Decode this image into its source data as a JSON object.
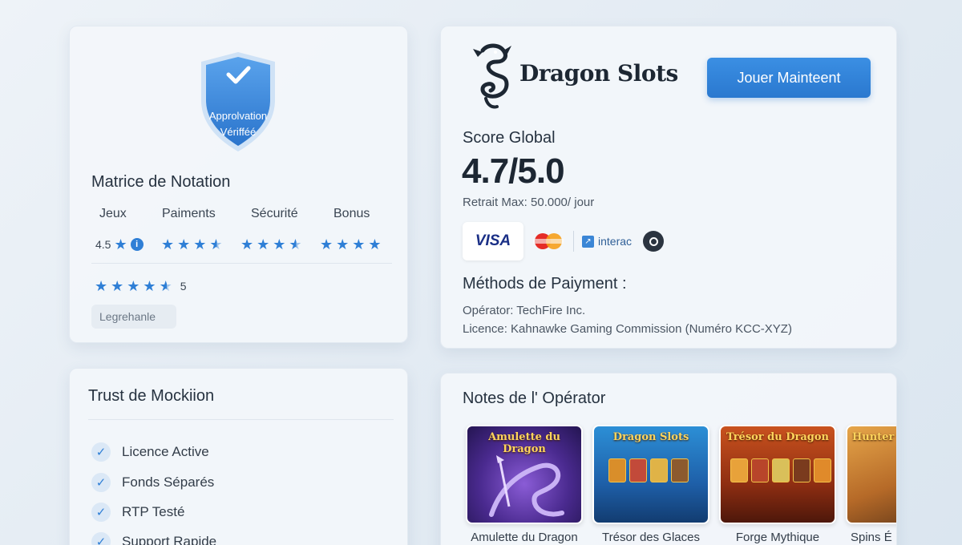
{
  "rating_card": {
    "shield_line1": "Approlvation",
    "shield_line2": "Vérifféé",
    "title": "Matrice de Notation",
    "columns": [
      "Jeux",
      "Paiments",
      "Sécurité",
      "Bonus"
    ],
    "jeux_score": "4.5",
    "overall_score": "5",
    "legend_label": "Legrehanle"
  },
  "brand_card": {
    "brand_name": "Dragon Slots",
    "play_button": "Jouer Mainteent",
    "score_label": "Score Global",
    "score_value": "4.7/5.0",
    "withdraw": "Retrait Max: 50.000/ jour",
    "visa_label": "VISA",
    "interac_label": "interac",
    "payment_title": "Méthods de Paiyment :",
    "operator": "Opérator: TechFire Inc.",
    "license": "Licence: Kahnawke Gaming Commission (Numéro KCC-XYZ)"
  },
  "trust_card": {
    "title": "Trust de Mockiion",
    "items": [
      "Licence Active",
      "Fonds Séparés",
      "RTP Testé",
      "Support Rapide"
    ]
  },
  "games_card": {
    "title": "Notes de l' Opérator",
    "games": [
      {
        "thumb_title": "Amulette du Dragon",
        "caption": "Amulette du Dragon"
      },
      {
        "thumb_title": "Dragon Slots",
        "caption": "Trésor des Glaces"
      },
      {
        "thumb_title": "Trésor du Dragon",
        "caption": "Forge Mythique"
      },
      {
        "thumb_title": "Hunter",
        "caption": "Spins É"
      }
    ]
  },
  "colors": {
    "accent": "#2f7fd6",
    "button": "#2a78cf",
    "background": "#e3ebf3"
  },
  "icons": [
    "verified-shield-icon",
    "star-icon",
    "info-icon",
    "dragon-logo-icon",
    "visa-icon",
    "mastercard-icon",
    "interac-icon",
    "payment-icon",
    "check-icon"
  ]
}
